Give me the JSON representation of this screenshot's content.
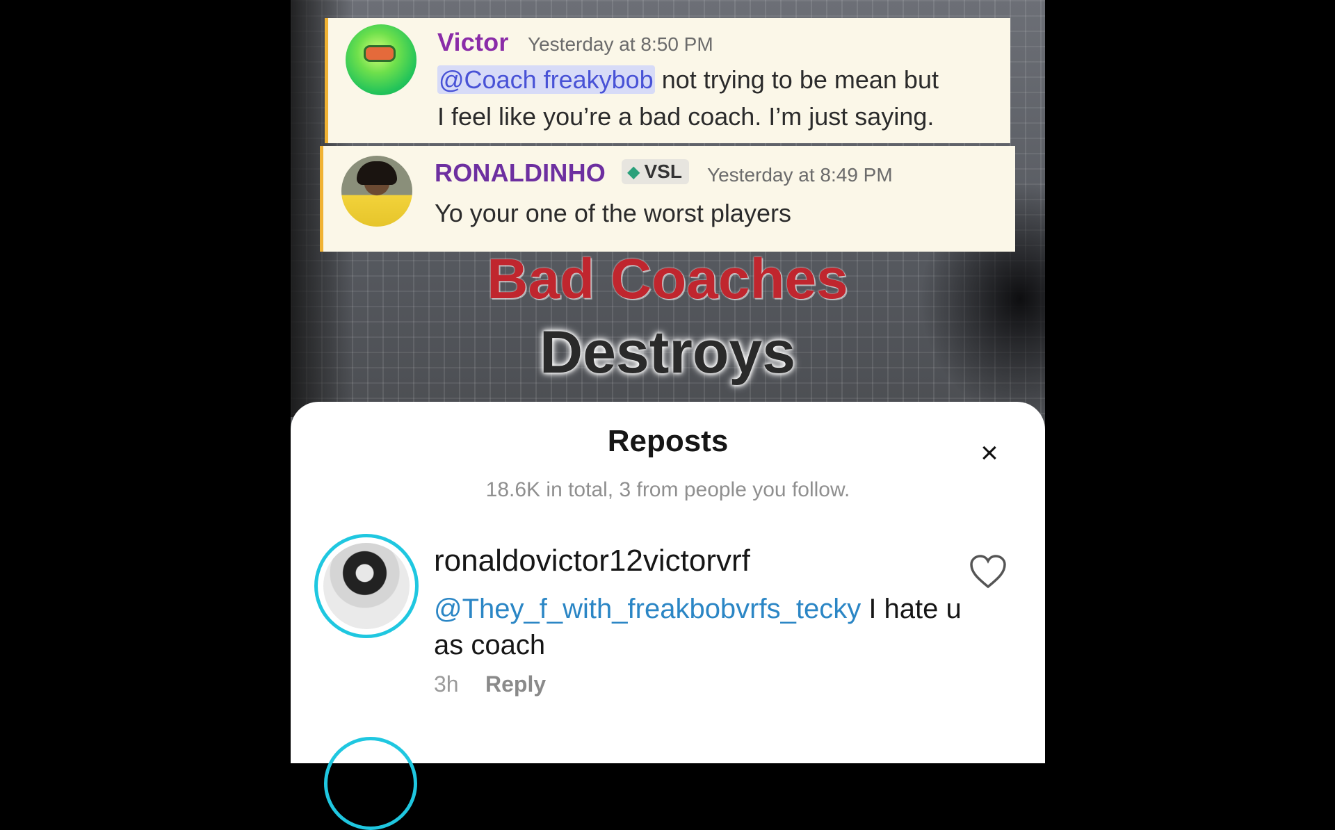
{
  "post1": {
    "author": "Victor",
    "time": "Yesterday at 8:50 PM",
    "mention": "@Coach freakybob",
    "text_line1": " not trying to be mean but",
    "text_line2": "I feel like you’re a bad coach. I’m just saying."
  },
  "post2": {
    "author": "RONALDINHO",
    "badge": "VSL",
    "time": "Yesterday at 8:49 PM",
    "text": "Yo your one of the worst players"
  },
  "overlay": {
    "line1": "Bad Coaches",
    "line2": "Destroys"
  },
  "sheet": {
    "title": "Reposts",
    "subtitle": "18.6K in total, 3 from people you follow.",
    "close_icon": "×"
  },
  "comment": {
    "username": "ronaldovictor12victorvrf",
    "mention": "@They_f_with_freakbobvrfs_tecky",
    "text": " I hate u as coach",
    "time": "3h",
    "reply_label": "Reply"
  },
  "colors": {
    "accent_bar": "#f0b233",
    "victor_name": "#8a2ca8",
    "ronaldinho_name": "#6d2fa0",
    "mention_blue": "#2b86c5",
    "story_ring": "#1fc7e0"
  }
}
